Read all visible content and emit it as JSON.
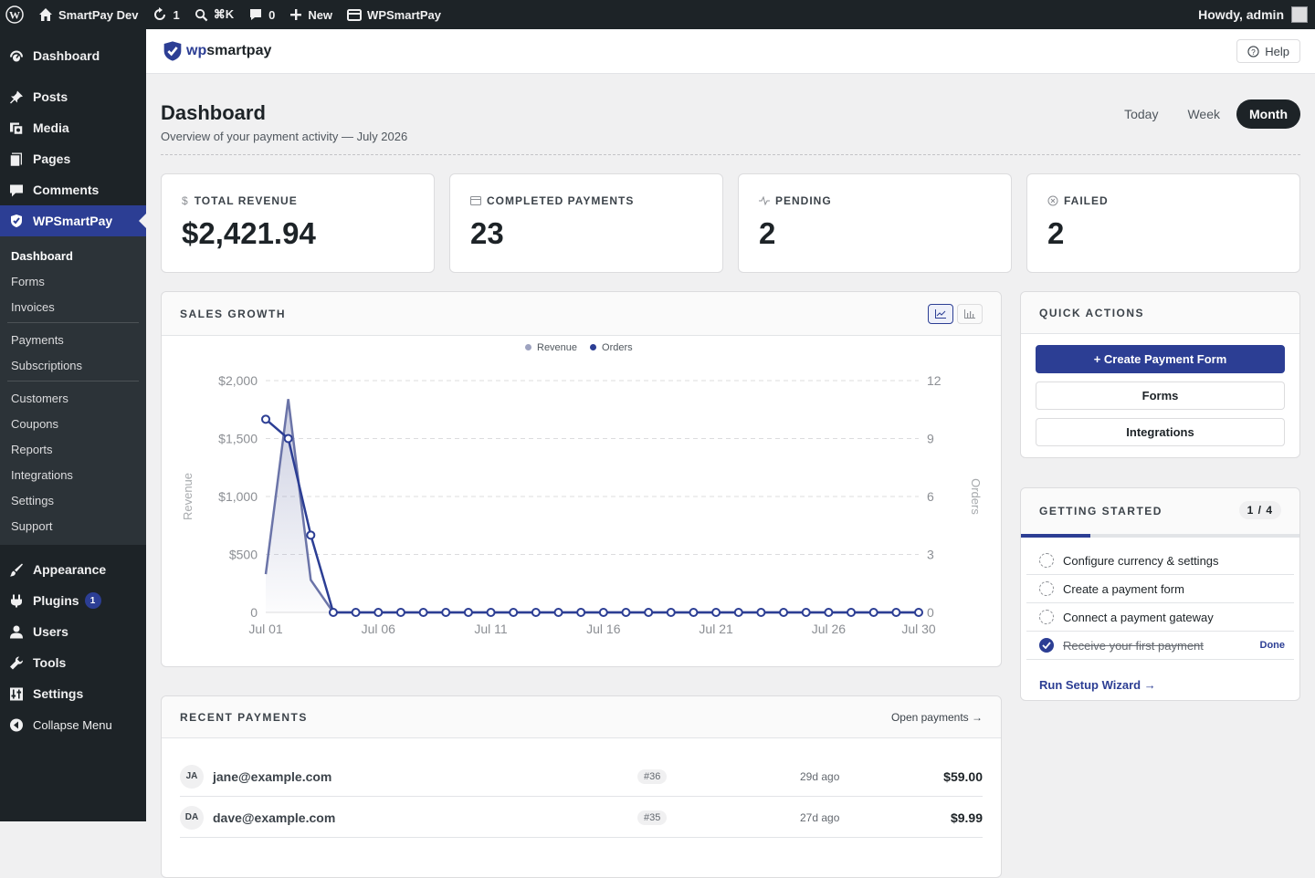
{
  "adminbar": {
    "site_name": "SmartPay Dev",
    "updates_count": "1",
    "search_shortcut": "⌘K",
    "comments_count": "0",
    "new_label": "New",
    "plugin_label": "WPSmartPay",
    "greeting": "Howdy, admin"
  },
  "sidebar": {
    "top_items": [
      {
        "label": "Dashboard",
        "icon": "dashboard-icon"
      },
      {
        "label": "Posts",
        "icon": "pin-icon"
      },
      {
        "label": "Media",
        "icon": "media-icon"
      },
      {
        "label": "Pages",
        "icon": "pages-icon"
      },
      {
        "label": "Comments",
        "icon": "comment-icon"
      },
      {
        "label": "WPSmartPay",
        "icon": "shield-icon"
      }
    ],
    "submenu": [
      "Dashboard",
      "Forms",
      "Invoices",
      "Payments",
      "Subscriptions",
      "Customers",
      "Coupons",
      "Reports",
      "Integrations",
      "Settings",
      "Support"
    ],
    "bottom_items": [
      {
        "label": "Appearance",
        "icon": "brush-icon"
      },
      {
        "label": "Plugins",
        "icon": "plug-icon",
        "badge": "1"
      },
      {
        "label": "Users",
        "icon": "user-icon"
      },
      {
        "label": "Tools",
        "icon": "wrench-icon"
      },
      {
        "label": "Settings",
        "icon": "sliders-icon"
      },
      {
        "label": "Collapse Menu",
        "icon": "collapse-icon"
      }
    ]
  },
  "topstrip": {
    "logo_prefix": "wp",
    "logo_text": "smartpay",
    "help_label": "Help"
  },
  "page": {
    "title": "Dashboard",
    "subtitle": "Overview of your payment activity — July 2026",
    "ranges": [
      "Today",
      "Week",
      "Month"
    ],
    "active_range": "Month"
  },
  "stats": [
    {
      "label": "TOTAL REVENUE",
      "value": "$2,421.94",
      "icon": "dollar-icon"
    },
    {
      "label": "COMPLETED PAYMENTS",
      "value": "23",
      "icon": "card-icon"
    },
    {
      "label": "PENDING",
      "value": "2",
      "icon": "pulse-icon"
    },
    {
      "label": "FAILED",
      "value": "2",
      "icon": "x-circle-icon"
    }
  ],
  "sales": {
    "heading": "SALES GROWTH"
  },
  "chart_data": {
    "type": "line",
    "title": "",
    "x": [
      "Jul 01",
      "Jul 02",
      "Jul 03",
      "Jul 04",
      "Jul 05",
      "Jul 06",
      "Jul 07",
      "Jul 08",
      "Jul 09",
      "Jul 10",
      "Jul 11",
      "Jul 12",
      "Jul 13",
      "Jul 14",
      "Jul 15",
      "Jul 16",
      "Jul 17",
      "Jul 18",
      "Jul 19",
      "Jul 20",
      "Jul 21",
      "Jul 22",
      "Jul 23",
      "Jul 24",
      "Jul 25",
      "Jul 26",
      "Jul 27",
      "Jul 28",
      "Jul 29",
      "Jul 30"
    ],
    "x_tick_labels": [
      "Jul 01",
      "Jul 06",
      "Jul 11",
      "Jul 16",
      "Jul 21",
      "Jul 26",
      "Jul 30"
    ],
    "ylabel": "Revenue",
    "y2label": "Orders",
    "ylim": [
      0,
      2000
    ],
    "y_ticks": [
      "0",
      "$500",
      "$1,000",
      "$1,500",
      "$2,000"
    ],
    "y2lim": [
      0,
      12
    ],
    "y2_ticks": [
      "0",
      "3",
      "6",
      "9",
      "12"
    ],
    "series": [
      {
        "name": "Revenue",
        "axis": "left",
        "style": "area",
        "color": "#6b74a8",
        "values": [
          330,
          1840,
          280,
          0,
          0,
          0,
          0,
          0,
          0,
          0,
          0,
          0,
          0,
          0,
          0,
          0,
          0,
          0,
          0,
          0,
          0,
          0,
          0,
          0,
          0,
          0,
          0,
          0,
          0,
          0
        ]
      },
      {
        "name": "Orders",
        "axis": "right",
        "style": "line-markers",
        "color": "#2c3e94",
        "values": [
          10,
          9,
          4,
          0,
          0,
          0,
          0,
          0,
          0,
          0,
          0,
          0,
          0,
          0,
          0,
          0,
          0,
          0,
          0,
          0,
          0,
          0,
          0,
          0,
          0,
          0,
          0,
          0,
          0,
          0
        ]
      }
    ],
    "legend": "top-center",
    "grid": true
  },
  "quick_actions": {
    "heading": "QUICK ACTIONS",
    "buttons": [
      "+ Create Payment Form",
      "Forms",
      "Integrations"
    ]
  },
  "getting_started": {
    "heading": "GETTING STARTED",
    "count": "1 / 4",
    "progress": 0.25,
    "items": [
      {
        "label": "Configure currency & settings",
        "done": false
      },
      {
        "label": "Create a payment form",
        "done": false
      },
      {
        "label": "Connect a payment gateway",
        "done": false
      },
      {
        "label": "Receive your first payment",
        "done": true,
        "done_label": "Done"
      }
    ],
    "wizard_link": "Run Setup Wizard →"
  },
  "recent_payments": {
    "heading": "RECENT PAYMENTS",
    "open_link": "Open payments →",
    "rows": [
      {
        "initials": "JA",
        "email": "jane@example.com",
        "id": "#36",
        "time": "29d ago",
        "amount": "$59.00"
      },
      {
        "initials": "DA",
        "email": "dave@example.com",
        "id": "#35",
        "time": "27d ago",
        "amount": "$9.99"
      }
    ]
  }
}
